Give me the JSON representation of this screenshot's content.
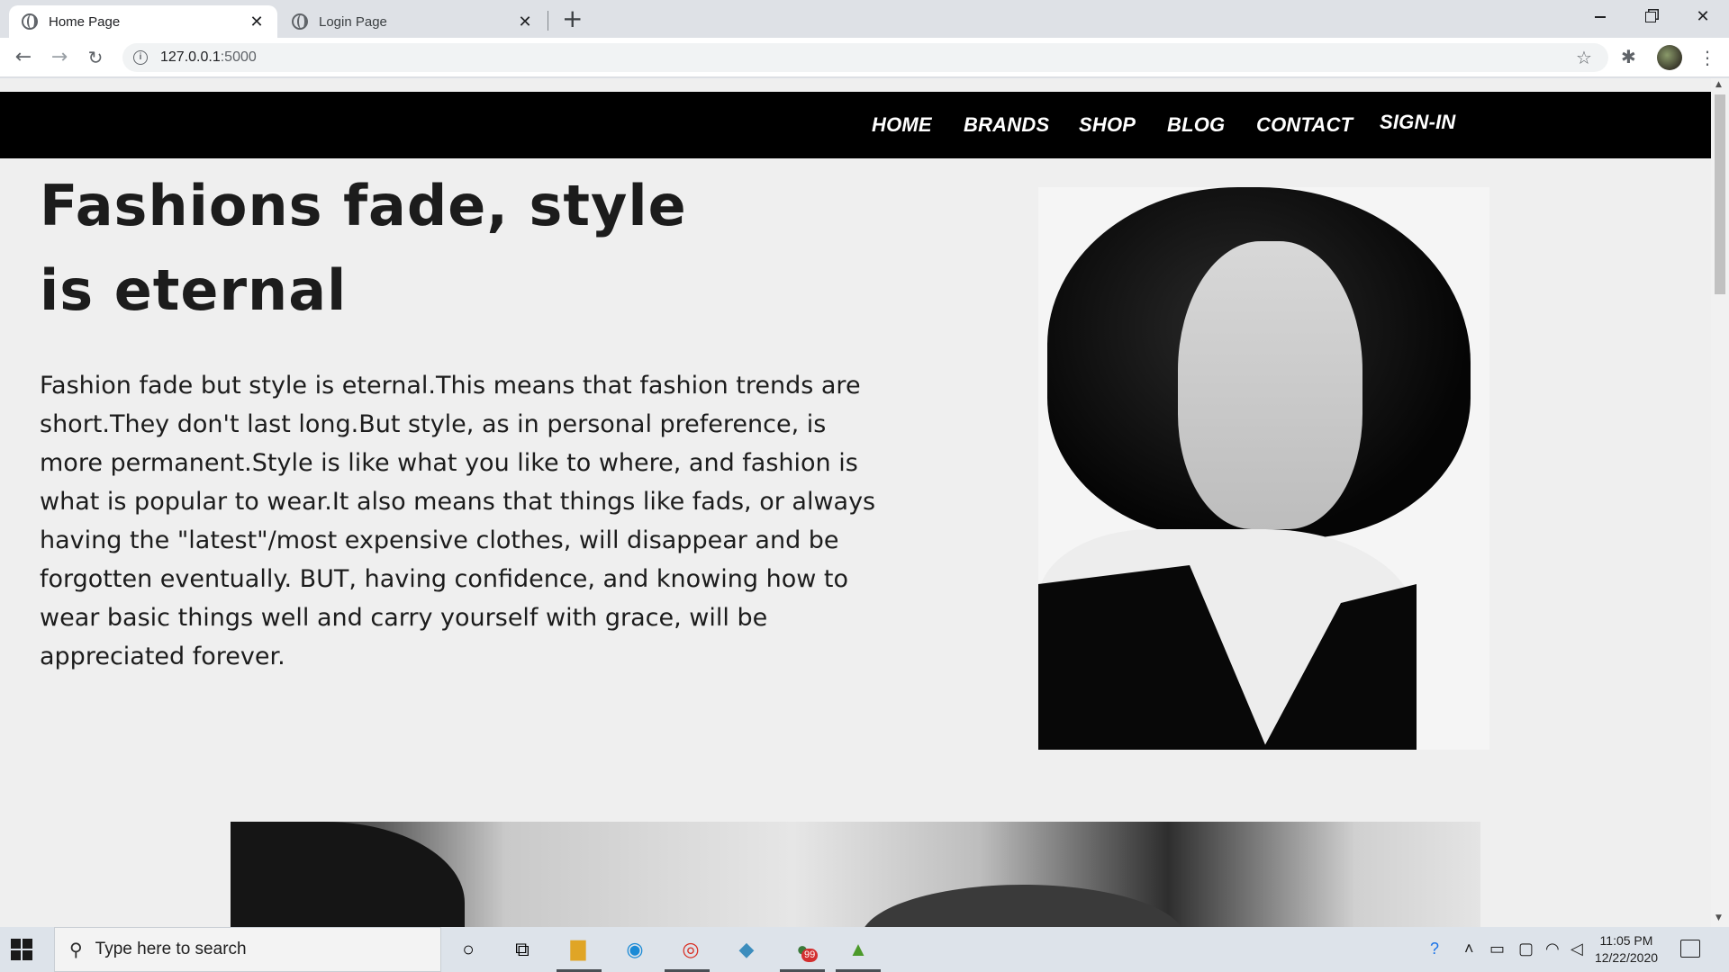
{
  "browser": {
    "tabs": [
      {
        "title": "Home Page",
        "active": true
      },
      {
        "title": "Login Page",
        "active": false
      }
    ],
    "new_tab_label": "+",
    "url_host": "127.0.0.1",
    "url_port": ":5000"
  },
  "site": {
    "nav": [
      "HOME",
      "BRANDS",
      "SHOP",
      "BLOG",
      "CONTACT",
      "SIGN-IN"
    ],
    "hero_title": "Fashions fade, style is eternal",
    "hero_text": "Fashion fade but style is eternal.This means that fashion trends are short.They don't last long.But style, as in personal preference, is more permanent.Style is like what you like to where, and fashion is what is popular to wear.It also means that things like fads, or always having the \"latest\"/most expensive clothes, will disappear and be forgotten eventually. BUT, having confidence, and knowing how to wear basic things well and carry yourself with grace, will be appreciated forever."
  },
  "taskbar": {
    "search_placeholder": "Type here to search",
    "time": "11:05 PM",
    "date": "12/22/2020",
    "badge_count": "99"
  },
  "colors": {
    "nav_bg": "#000000",
    "page_bg": "#efefef",
    "nav_text": "#ffffff"
  }
}
